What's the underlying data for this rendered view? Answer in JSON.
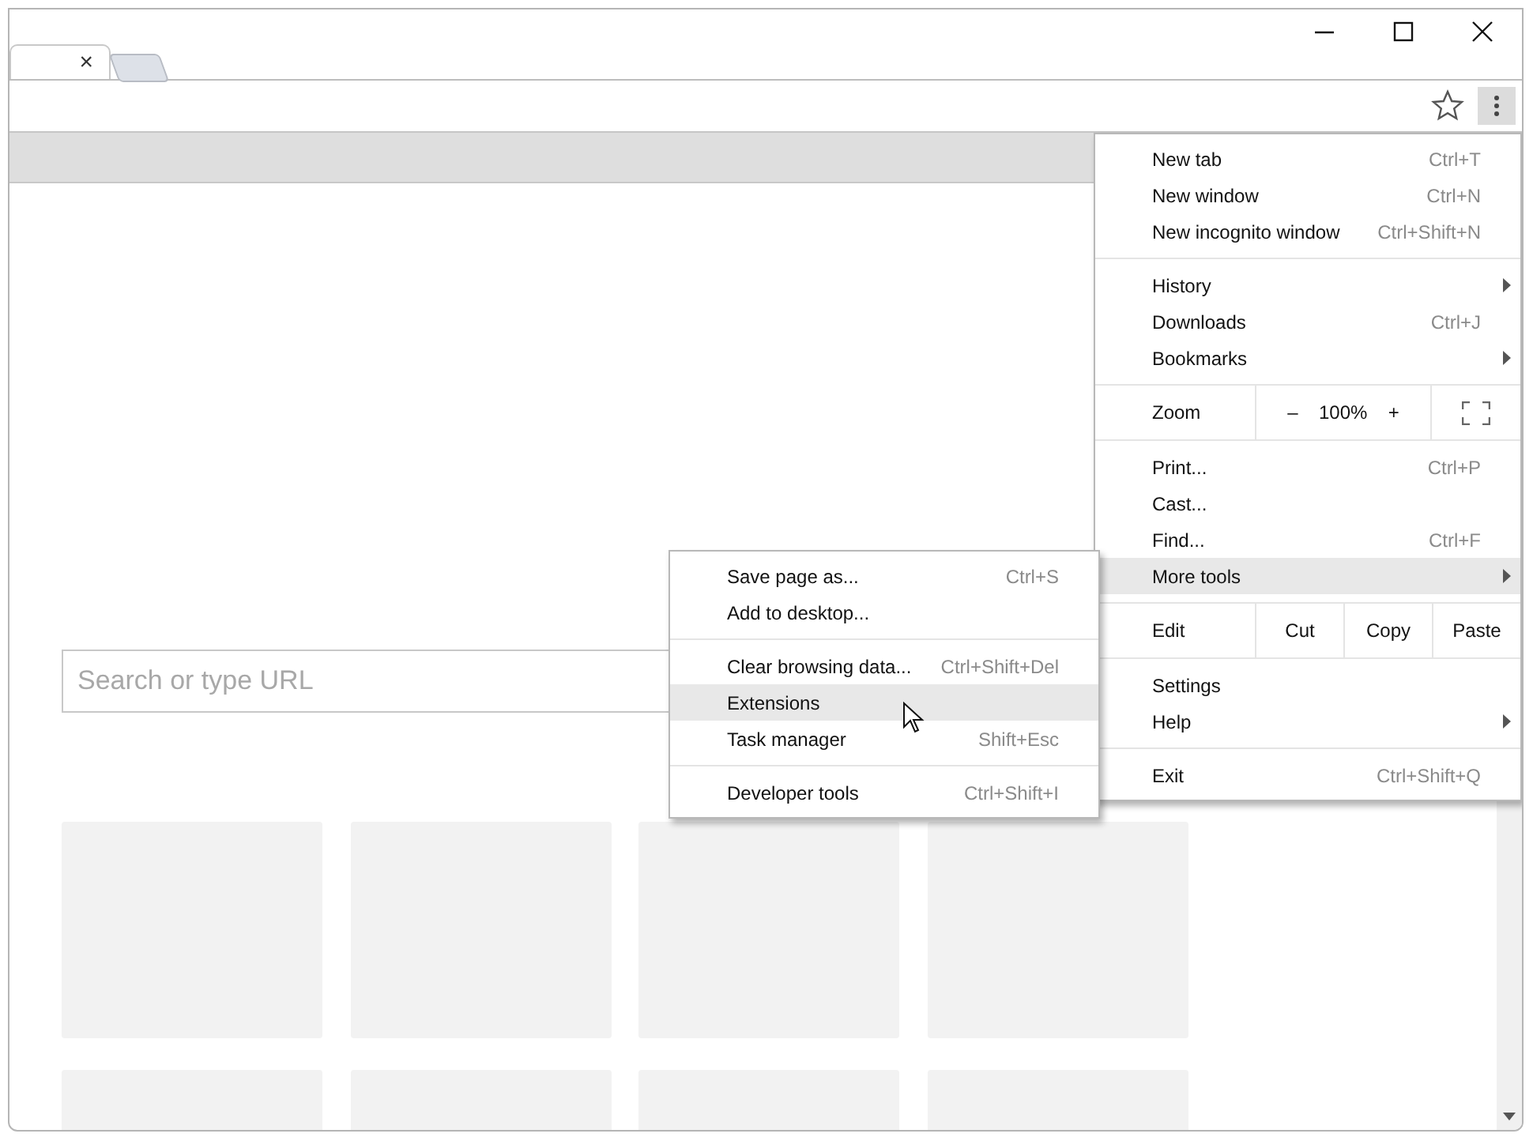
{
  "tab": {
    "close": "×",
    "selected": true
  },
  "search": {
    "placeholder": "Search or type URL"
  },
  "menu": [
    {
      "kind": "item",
      "label": "New tab",
      "shortcut": "Ctrl+T",
      "has_submenu": false,
      "selected": false
    },
    {
      "kind": "item",
      "label": "New window",
      "shortcut": "Ctrl+N",
      "has_submenu": false,
      "selected": false
    },
    {
      "kind": "item",
      "label": "New incognito window",
      "shortcut": "Ctrl+Shift+N",
      "has_submenu": false,
      "selected": false
    },
    {
      "kind": "separator"
    },
    {
      "kind": "item",
      "label": "History",
      "has_submenu": true,
      "selected": false
    },
    {
      "kind": "item",
      "label": "Downloads",
      "shortcut": "Ctrl+J",
      "has_submenu": false,
      "selected": false
    },
    {
      "kind": "item",
      "label": "Bookmarks",
      "has_submenu": true,
      "selected": false
    },
    {
      "kind": "zoom",
      "label": "Zoom",
      "minus": "–",
      "value": "100%",
      "plus": "+"
    },
    {
      "kind": "item",
      "label": "Print...",
      "shortcut": "Ctrl+P",
      "has_submenu": false,
      "selected": false
    },
    {
      "kind": "item",
      "label": "Cast...",
      "has_submenu": false,
      "selected": false
    },
    {
      "kind": "item",
      "label": "Find...",
      "shortcut": "Ctrl+F",
      "has_submenu": false,
      "selected": false
    },
    {
      "kind": "item",
      "label": "More tools",
      "has_submenu": true,
      "selected": true
    },
    {
      "kind": "edit",
      "label": "Edit",
      "cut": "Cut",
      "copy": "Copy",
      "paste": "Paste"
    },
    {
      "kind": "item",
      "label": "Settings",
      "has_submenu": false,
      "selected": false
    },
    {
      "kind": "item",
      "label": "Help",
      "has_submenu": true,
      "selected": false
    },
    {
      "kind": "separator"
    },
    {
      "kind": "item",
      "label": "Exit",
      "shortcut": "Ctrl+Shift+Q",
      "has_submenu": false,
      "selected": false
    }
  ],
  "submenu": [
    {
      "kind": "item",
      "label": "Save page as...",
      "shortcut": "Ctrl+S",
      "selected": false
    },
    {
      "kind": "item",
      "label": "Add to desktop...",
      "selected": false
    },
    {
      "kind": "separator"
    },
    {
      "kind": "item",
      "label": "Clear browsing data...",
      "shortcut": "Ctrl+Shift+Del",
      "selected": false
    },
    {
      "kind": "item",
      "label": "Extensions",
      "selected": true
    },
    {
      "kind": "item",
      "label": "Task manager",
      "shortcut": "Shift+Esc",
      "selected": false
    },
    {
      "kind": "separator"
    },
    {
      "kind": "item",
      "label": "Developer tools",
      "shortcut": "Ctrl+Shift+I",
      "selected": false
    }
  ]
}
